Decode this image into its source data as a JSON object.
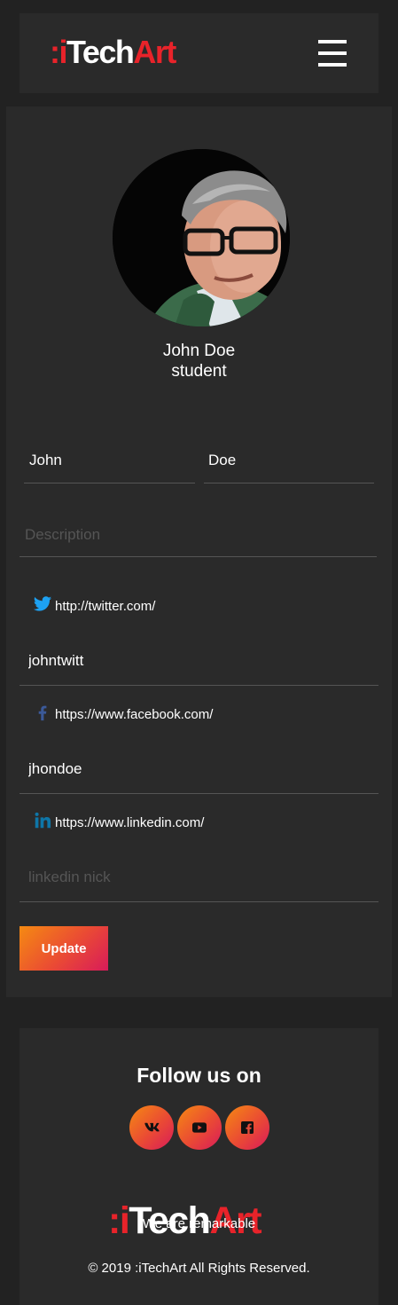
{
  "header": {
    "logo": {
      "dots": ":i",
      "tech": "Tech",
      "art": "Art"
    },
    "menu_icon": "hamburger-menu-icon"
  },
  "profile": {
    "name": "John Doe",
    "role": "student",
    "first_name": "John",
    "last_name": "Doe",
    "description_placeholder": "Description",
    "description": ""
  },
  "social": [
    {
      "icon": "twitter-icon",
      "color": "#1da1f2",
      "url": "http://twitter.com/",
      "value": "johntwitt",
      "placeholder": ""
    },
    {
      "icon": "facebook-icon",
      "color": "#3b5998",
      "url": "https://www.facebook.com/",
      "value": "jhondoe",
      "placeholder": ""
    },
    {
      "icon": "linkedin-icon",
      "color": "#0e76a8",
      "url": "https://www.linkedin.com/",
      "value": "",
      "placeholder": "linkedin nick"
    }
  ],
  "update_label": "Update",
  "footer": {
    "follow_title": "Follow us on",
    "social_icons": [
      "vk-icon",
      "youtube-icon",
      "facebook-square-icon"
    ],
    "logo": {
      "dots": ":i",
      "tech": "Tech",
      "art": "Art"
    },
    "tagline": "We are remarkable",
    "copyright": "© 2019 :iTechArt All Rights Reserved."
  },
  "colors": {
    "background": "#222222",
    "panel": "#2a2a2a",
    "brand_red": "#e8232a",
    "gradient_start": "#f58a12",
    "gradient_end": "#d81b5a"
  }
}
